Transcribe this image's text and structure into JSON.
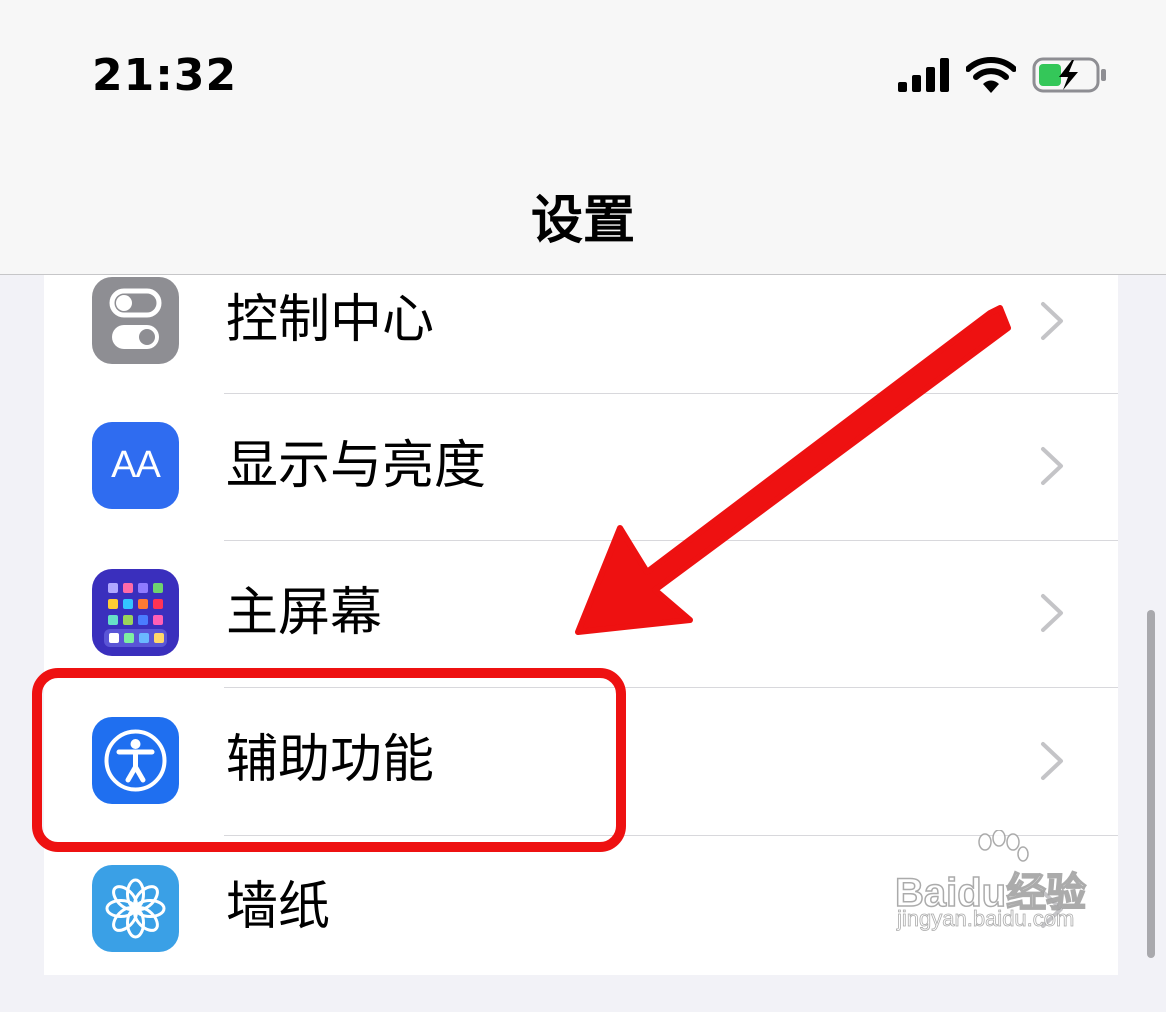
{
  "status_bar": {
    "time": "21:32",
    "icons": [
      "signal-icon",
      "wifi-icon",
      "battery-charging-icon"
    ],
    "battery_color": "#34c759"
  },
  "nav": {
    "title": "设置"
  },
  "settings_items": [
    {
      "label": "控制中心",
      "icon": "control-center-icon",
      "icon_color": "#8e8e93"
    },
    {
      "label": "显示与亮度",
      "icon": "display-brightness-icon",
      "icon_text": "AA",
      "icon_color": "#2f6cf0"
    },
    {
      "label": "主屏幕",
      "icon": "home-screen-icon",
      "icon_color": "#3a2fbd"
    },
    {
      "label": "辅助功能",
      "icon": "accessibility-icon",
      "icon_color": "#1f6ff0"
    },
    {
      "label": "墙纸",
      "icon": "wallpaper-icon",
      "icon_color": "#3aa0e6"
    }
  ],
  "annotation": {
    "color": "#ee1111",
    "highlighted_item": "辅助功能"
  },
  "watermark": {
    "brand": "Baidu经验",
    "url": "jingyan.baidu.com"
  }
}
